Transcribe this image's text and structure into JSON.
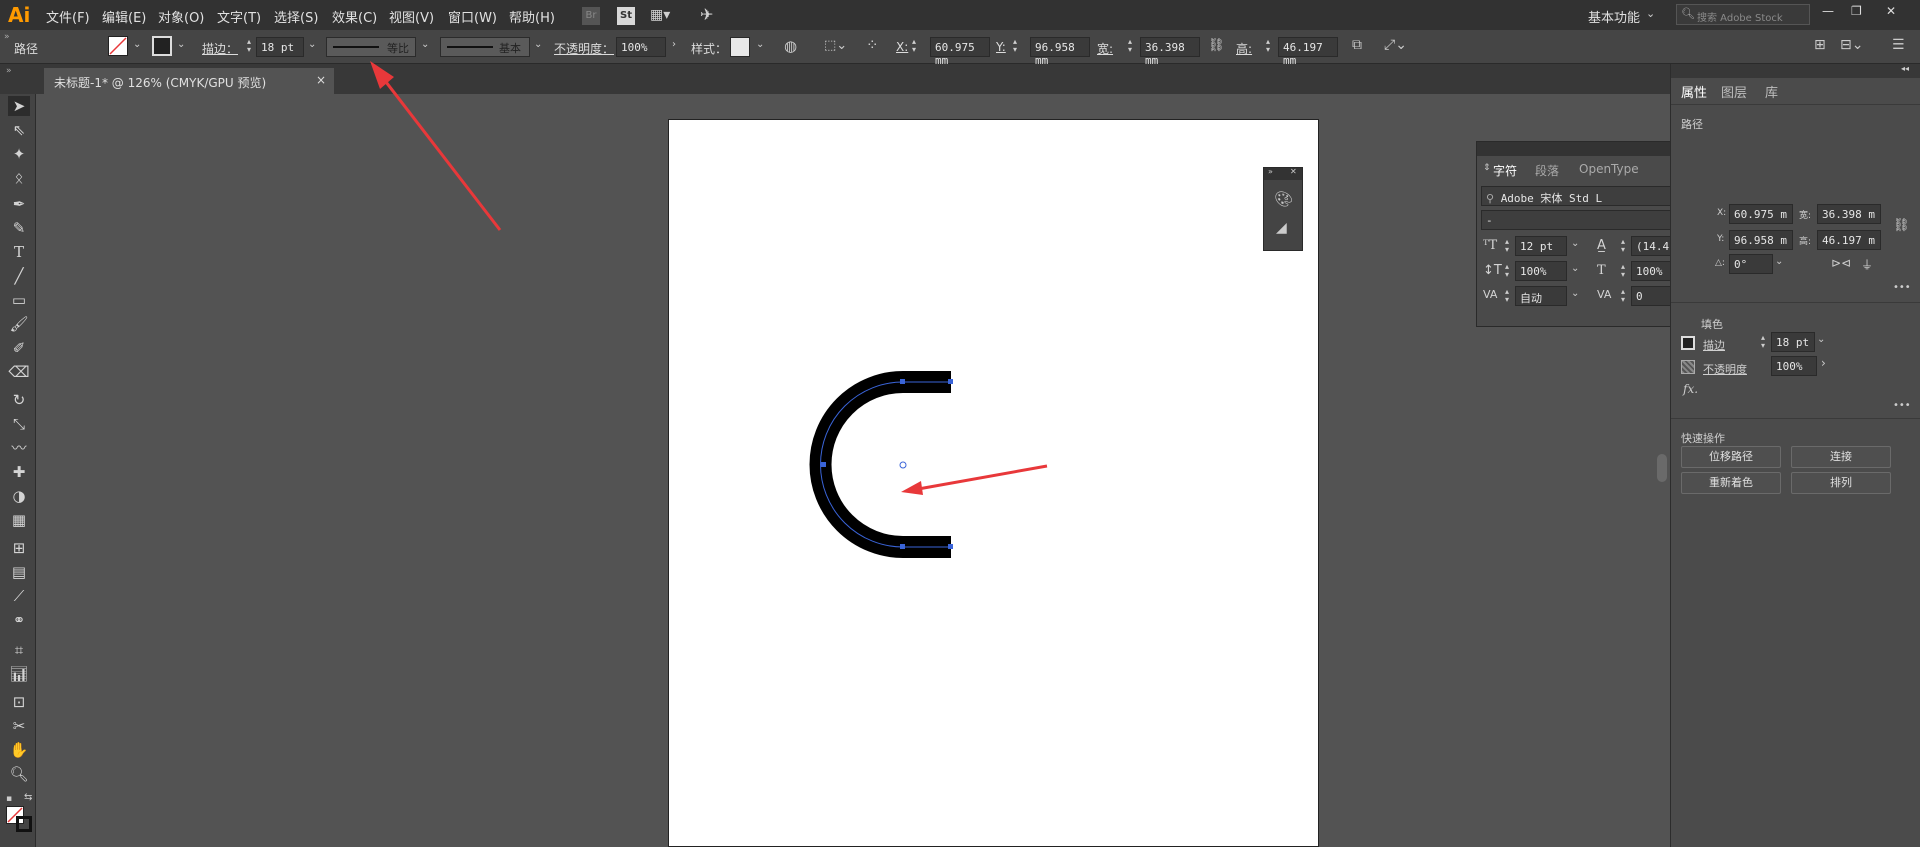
{
  "app": {
    "logo": "Ai"
  },
  "menu": [
    "文件(F)",
    "编辑(E)",
    "对象(O)",
    "文字(T)",
    "选择(S)",
    "效果(C)",
    "视图(V)",
    "窗口(W)",
    "帮助(H)"
  ],
  "menubar_right": {
    "br": "Br",
    "st": "St",
    "workspace": "基本功能",
    "search_placeholder": "搜索 Adobe Stock",
    "window_controls": [
      "—",
      "❐",
      "✕"
    ]
  },
  "options_bar": {
    "path_label": "路径",
    "stroke_label": "描边：",
    "stroke_value": "18 pt",
    "profile_label": "等比",
    "brush_label": "基本",
    "opacity_label": "不透明度：",
    "opacity_value": "100%",
    "style_label": "样式：",
    "x_label": "X:",
    "x_value": "60.975 mm",
    "y_label": "Y:",
    "y_value": "96.958 mm",
    "w_label": "宽:",
    "w_value": "36.398 mm",
    "h_label": "高:",
    "h_value": "46.197 mm"
  },
  "document": {
    "tab_title": "未标题-1* @ 126% (CMYK/GPU 预览)",
    "tab_close": "×"
  },
  "character_panel": {
    "tabs": [
      "字符",
      "段落",
      "OpenType"
    ],
    "font_family": "Adobe 宋体 Std L",
    "font_style": "-",
    "font_size": "12 pt",
    "leading": "(14.4",
    "vscale": "100%",
    "hscale": "100%",
    "kerning": "自动",
    "tracking": "0"
  },
  "properties_panel": {
    "tabs": [
      "属性",
      "图层",
      "库"
    ],
    "section": "路径",
    "x_label": "X:",
    "x_value": "60.975 m",
    "y_label": "Y:",
    "y_value": "96.958 m",
    "w_label": "宽:",
    "w_value": "36.398 m",
    "h_label": "高:",
    "h_value": "46.197 m",
    "angle_label": "△:",
    "angle_value": "0°",
    "appearance_label": "填色",
    "stroke_label": "描边",
    "stroke_value": "18 pt",
    "opacity_label": "不透明度",
    "opacity_value": "100%",
    "fx": "fx.",
    "quick_actions_title": "快速操作",
    "buttons": [
      "位移路径",
      "连接",
      "重新着色",
      "排列"
    ],
    "more": "•••"
  },
  "colors": {
    "accent_arrow": "#e8383a",
    "logo": "#ff9a00",
    "path_selection": "#3a64d8"
  }
}
